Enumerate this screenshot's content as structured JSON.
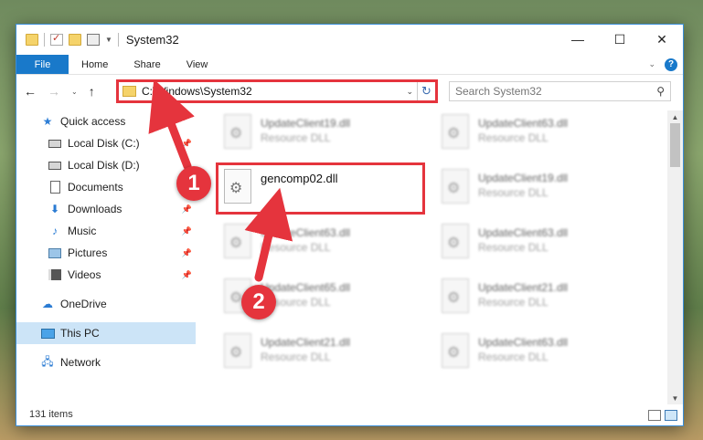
{
  "window": {
    "title": "System32",
    "controls": {
      "minimize": "—",
      "maximize": "☐",
      "close": "✕"
    }
  },
  "ribbon": {
    "tabs": [
      "File",
      "Home",
      "Share",
      "View"
    ],
    "collapse_glyph": "⌄",
    "help_glyph": "?"
  },
  "nav_buttons": {
    "back": "←",
    "forward": "→",
    "recent": "⌄",
    "up": "↑"
  },
  "address": {
    "path": "C:\\Windows\\System32",
    "dropdown_glyph": "⌄",
    "refresh_glyph": "↻"
  },
  "search": {
    "placeholder": "Search System32",
    "icon_glyph": "⚲"
  },
  "navigation_pane": {
    "quick_access": "Quick access",
    "items": [
      {
        "label": "Local Disk (C:)",
        "icon": "drive-icon",
        "pinned": true
      },
      {
        "label": "Local Disk (D:)",
        "icon": "drive-icon",
        "pinned": false
      },
      {
        "label": "Documents",
        "icon": "documents-icon",
        "pinned": true
      },
      {
        "label": "Downloads",
        "icon": "downloads-icon",
        "pinned": true
      },
      {
        "label": "Music",
        "icon": "music-icon",
        "pinned": true
      },
      {
        "label": "Pictures",
        "icon": "pictures-icon",
        "pinned": true
      },
      {
        "label": "Videos",
        "icon": "videos-icon",
        "pinned": true
      }
    ],
    "onedrive": "OneDrive",
    "this_pc": "This PC",
    "network": "Network",
    "pin_glyph": "📌"
  },
  "files": [
    {
      "name": "UpdateClient19.dll",
      "type": "Resource DLL"
    },
    {
      "name": "UpdateClient63.dll",
      "type": "Resource DLL"
    },
    {
      "name": "gencomp02.dll",
      "type": ""
    },
    {
      "name": "UpdateClient19.dll",
      "type": "Resource DLL"
    },
    {
      "name": "UpdateClient63.dll",
      "type": "Resource DLL"
    },
    {
      "name": "UpdateClient63.dll",
      "type": "Resource DLL"
    },
    {
      "name": "UpdateClient65.dll",
      "type": "Resource DLL"
    },
    {
      "name": "UpdateClient21.dll",
      "type": "Resource DLL"
    },
    {
      "name": "UpdateClient21.dll",
      "type": "Resource DLL"
    },
    {
      "name": "UpdateClient63.dll",
      "type": "Resource DLL"
    }
  ],
  "status": {
    "item_count": "131 items"
  },
  "annotations": {
    "step1": "1",
    "step2": "2",
    "color": "#e5343d"
  }
}
